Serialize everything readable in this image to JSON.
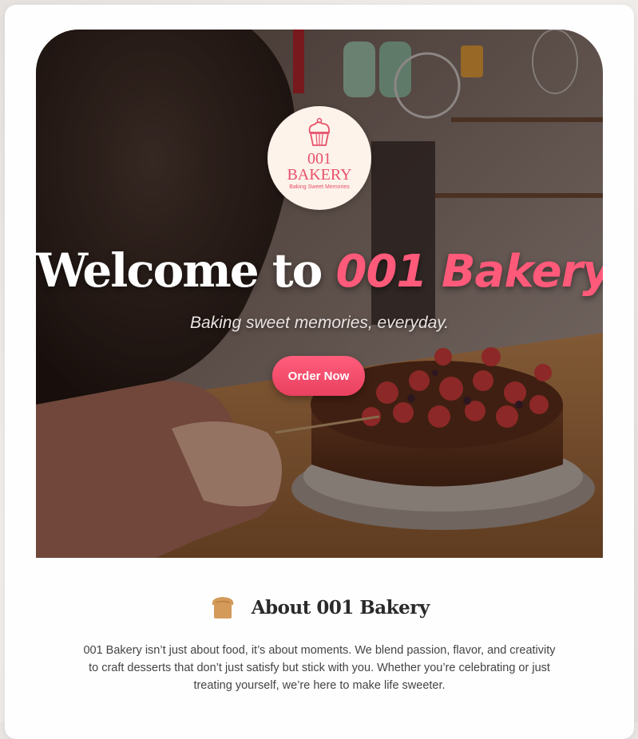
{
  "logo": {
    "line1": "001",
    "line2": "BAKERY",
    "tagline": "Baking Sweet Memories",
    "icon": "cupcake-icon"
  },
  "hero": {
    "title_plain": "Welcome to ",
    "title_accent": "001 Bakery",
    "subtitle": "Baking sweet memories, everyday.",
    "cta_label": "Order Now",
    "photo_description_icon": "bakery-hero-photo"
  },
  "about": {
    "icon": "bread-icon",
    "title": "About 001 Bakery",
    "body": "001 Bakery isn’t just about food, it’s about moments. We blend passion, flavor, and creativity to craft desserts that don’t just satisfy but stick with you. Whether you’re celebrating or just treating yourself, we’re here to make life sweeter."
  },
  "colors": {
    "accent": "#ff5a7a",
    "button": "#e9405f",
    "logo_bg": "#fdf3ea",
    "bread": "#d39a5a"
  }
}
